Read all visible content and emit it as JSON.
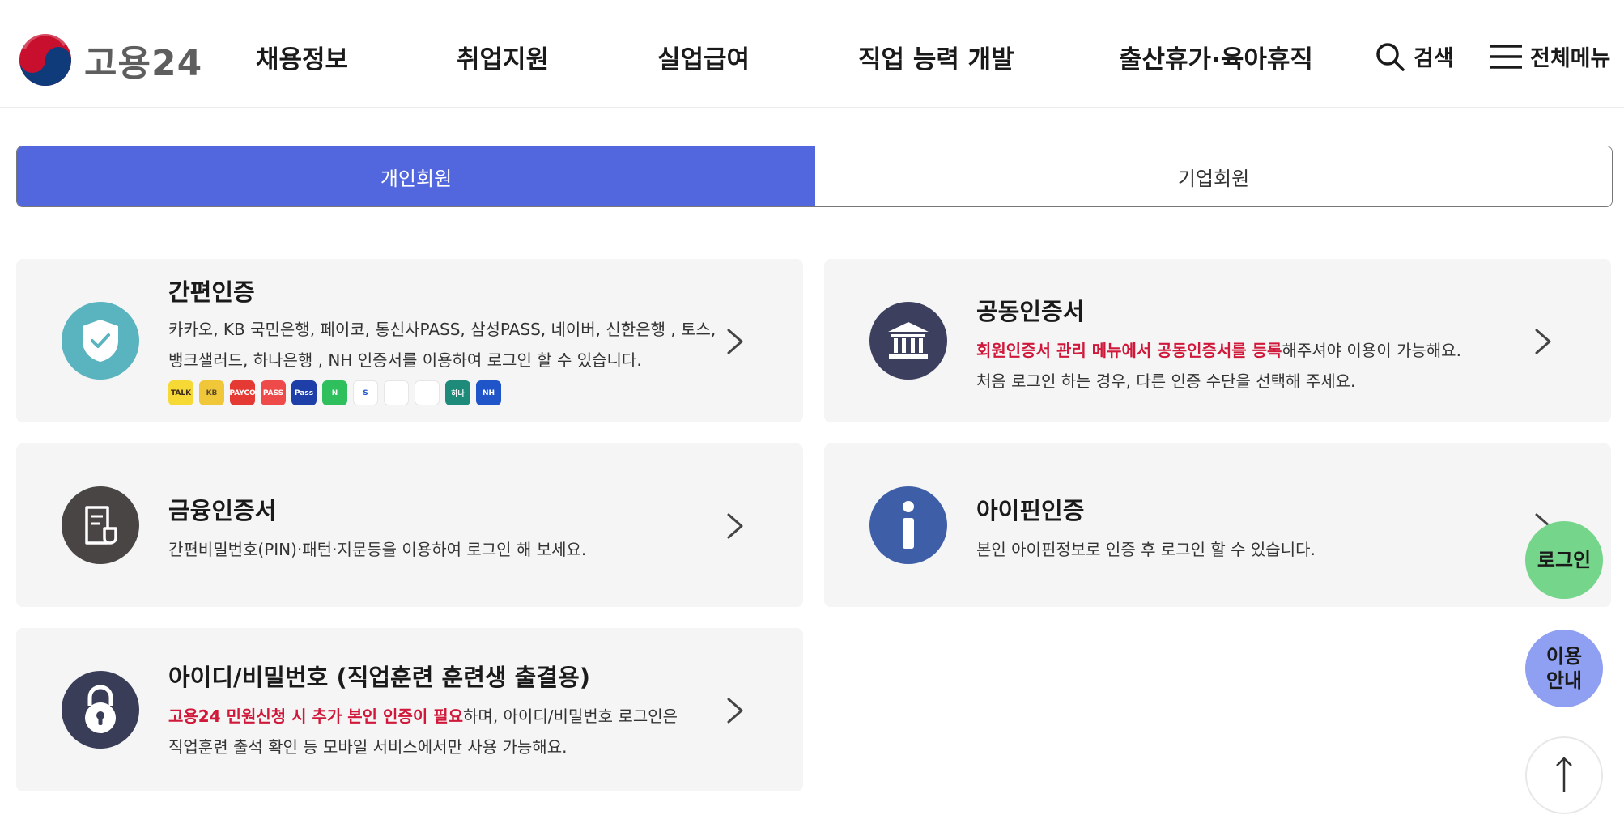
{
  "header": {
    "logo_text": "고용24",
    "nav": [
      "채용정보",
      "취업지원",
      "실업급여",
      "직업 능력 개발",
      "출산휴가·육아휴직"
    ],
    "search_label": "검색",
    "menu_label": "전체메뉴"
  },
  "tabs": {
    "personal": "개인회원",
    "corporate": "기업회원"
  },
  "cards": {
    "simple": {
      "title": "간편인증",
      "line1": "카카오, KB 국민은행, 페이코, 통신사PASS, 삼성PASS, 네이버, 신한은행 , 토스,",
      "line2": "뱅크샐러드, 하나은행 , NH 인증서를 이용하여 로그인 할 수 있습니다.",
      "brands": [
        {
          "label": "TALK",
          "color": "#f7d935",
          "text": "#3a2a1a"
        },
        {
          "label": "KB",
          "color": "#f1c73a",
          "text": "#5a4a2a"
        },
        {
          "label": "PAYCO",
          "color": "#e53a33",
          "text": "#ffffff"
        },
        {
          "label": "PASS",
          "color": "#ef4a4a",
          "text": "#ffffff"
        },
        {
          "label": "Pass",
          "color": "#1e3fa8",
          "text": "#ffffff"
        },
        {
          "label": "N",
          "color": "#2fc05d",
          "text": "#ffffff"
        },
        {
          "label": "S",
          "color": "#ffffff",
          "text": "#2559c9"
        },
        {
          "label": "",
          "color": "#ffffff",
          "text": "#2b7de9"
        },
        {
          "label": "",
          "color": "#ffffff",
          "text": "#2fb26a"
        },
        {
          "label": "하나",
          "color": "#1d8a7a",
          "text": "#ffffff"
        },
        {
          "label": "NH",
          "color": "#1f55c9",
          "text": "#ffffff"
        }
      ]
    },
    "joint": {
      "title": "공동인증서",
      "line1_highlight": "회원인증서 관리 메뉴에서 공동인증서를 등록",
      "line1_rest": "해주셔야 이용이 가능해요.",
      "line2": "처음 로그인 하는 경우, 다른 인증 수단을 선택해 주세요."
    },
    "financial": {
      "title": "금융인증서",
      "line1": "간편비밀번호(PIN)·패턴·지문등을 이용하여 로그인 해 보세요."
    },
    "ipin": {
      "title": "아이핀인증",
      "line1": "본인 아이핀정보로 인증 후 로그인 할 수 있습니다."
    },
    "idpw": {
      "title": "아이디/비밀번호 (직업훈련 훈련생 출결용)",
      "line1_highlight": "고용24 민원신청 시 추가 본인 인증이 필요",
      "line1_rest": "하며, 아이디/비밀번호 로그인은",
      "line2": "직업훈련 출석 확인 등 모바일 서비스에서만 사용 가능해요."
    }
  },
  "floating": {
    "login": "로그인",
    "guide_line1": "이용",
    "guide_line2": "안내",
    "top_icon": "arrow-up-icon"
  },
  "colors": {
    "accent": "#5267dd",
    "highlight": "#d0183a",
    "login_fab": "#74d58b",
    "guide_fab": "#8f9ff2"
  }
}
